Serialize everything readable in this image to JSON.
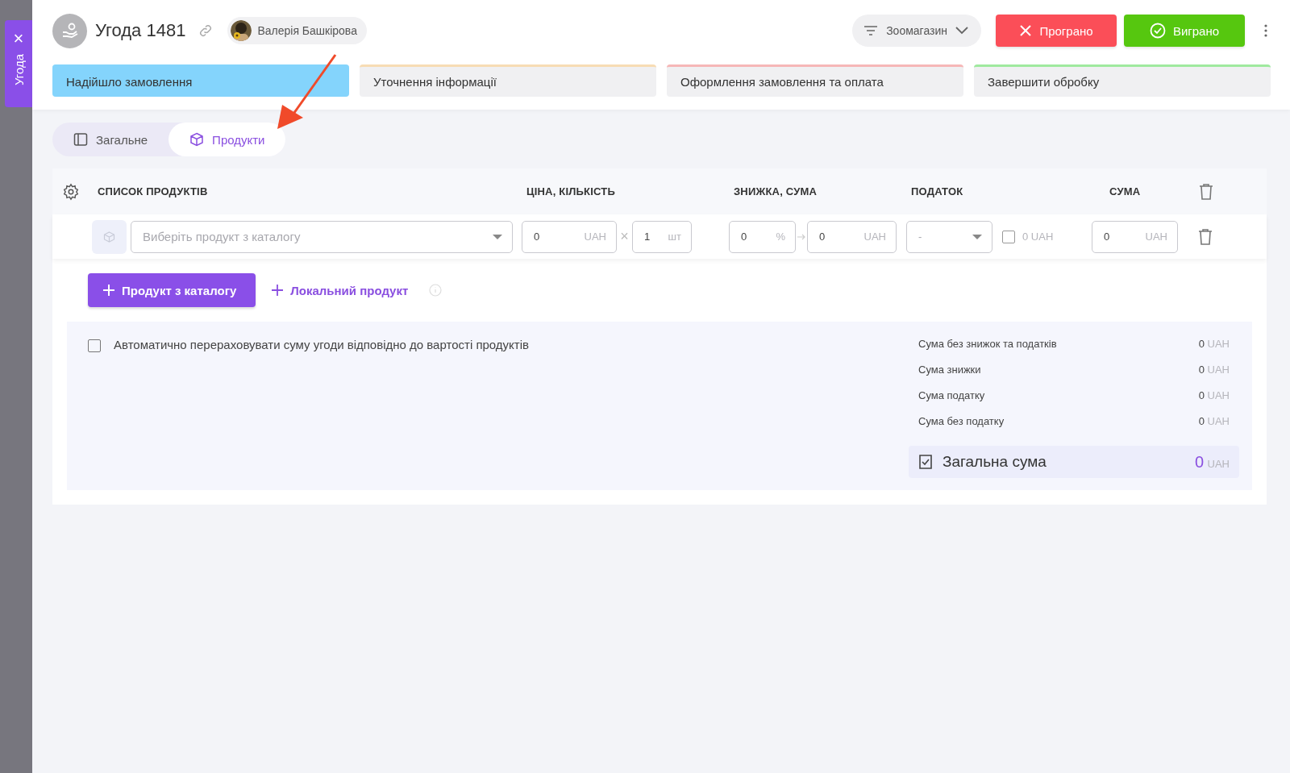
{
  "side_tab": {
    "label": "Угода",
    "close": "×"
  },
  "header": {
    "title": "Угода 1481",
    "user": "Валерія Башкірова",
    "pipeline": "Зоомагазин",
    "lost_button": "Програно",
    "won_button": "Виграно"
  },
  "stages": [
    {
      "label": "Надійшло замовлення",
      "selected": true,
      "color": "#84d4fc"
    },
    {
      "label": "Уточнення інформації",
      "selected": false,
      "color": "#f7dcb4"
    },
    {
      "label": "Оформлення замовлення та оплата",
      "selected": false,
      "color": "#f6b7b7"
    },
    {
      "label": "Завершити обробку",
      "selected": false,
      "color": "#9fe99f"
    }
  ],
  "tabs": [
    {
      "label": "Загальне",
      "selected": false,
      "kind": "panel"
    },
    {
      "label": "Продукти",
      "selected": true,
      "kind": "box"
    }
  ],
  "table": {
    "columns": [
      "СПИСОК ПРОДУКТІВ",
      "ЦІНА, КІЛЬКІСТЬ",
      "ЗНИЖКА, СУМА",
      "ПОДАТОК",
      "СУМА"
    ],
    "rows": [
      {
        "product_placeholder": "Виберіть продукт з каталогу",
        "price": "0",
        "price_unit": "UAH",
        "times": "×",
        "quantity": "1",
        "quantity_unit": "шт",
        "discount": "0",
        "discount_unit": "%",
        "discount_sum": "0",
        "discount_sum_unit": "UAH",
        "tax": "-",
        "tax_included": false,
        "tax_amount": "0",
        "tax_unit": "UAH",
        "sum": "0",
        "sum_unit": "UAH"
      }
    ]
  },
  "actions": {
    "catalog_button": "Продукт з каталогу",
    "local_button": "Локальний продукт"
  },
  "auto_recalc": {
    "label": "Автоматично перераховувати суму угоди відповідно до вартості продуктів",
    "checked": false
  },
  "summary": [
    {
      "label": "Сума без знижок та податків",
      "value": "0",
      "unit": "UAH"
    },
    {
      "label": "Сума знижки",
      "value": "0",
      "unit": "UAH"
    },
    {
      "label": "Сума податку",
      "value": "0",
      "unit": "UAH"
    },
    {
      "label": "Сума без податку",
      "value": "0",
      "unit": "UAH"
    }
  ],
  "total": {
    "label": "Загальна сума",
    "value": "0",
    "unit": "UAH"
  }
}
